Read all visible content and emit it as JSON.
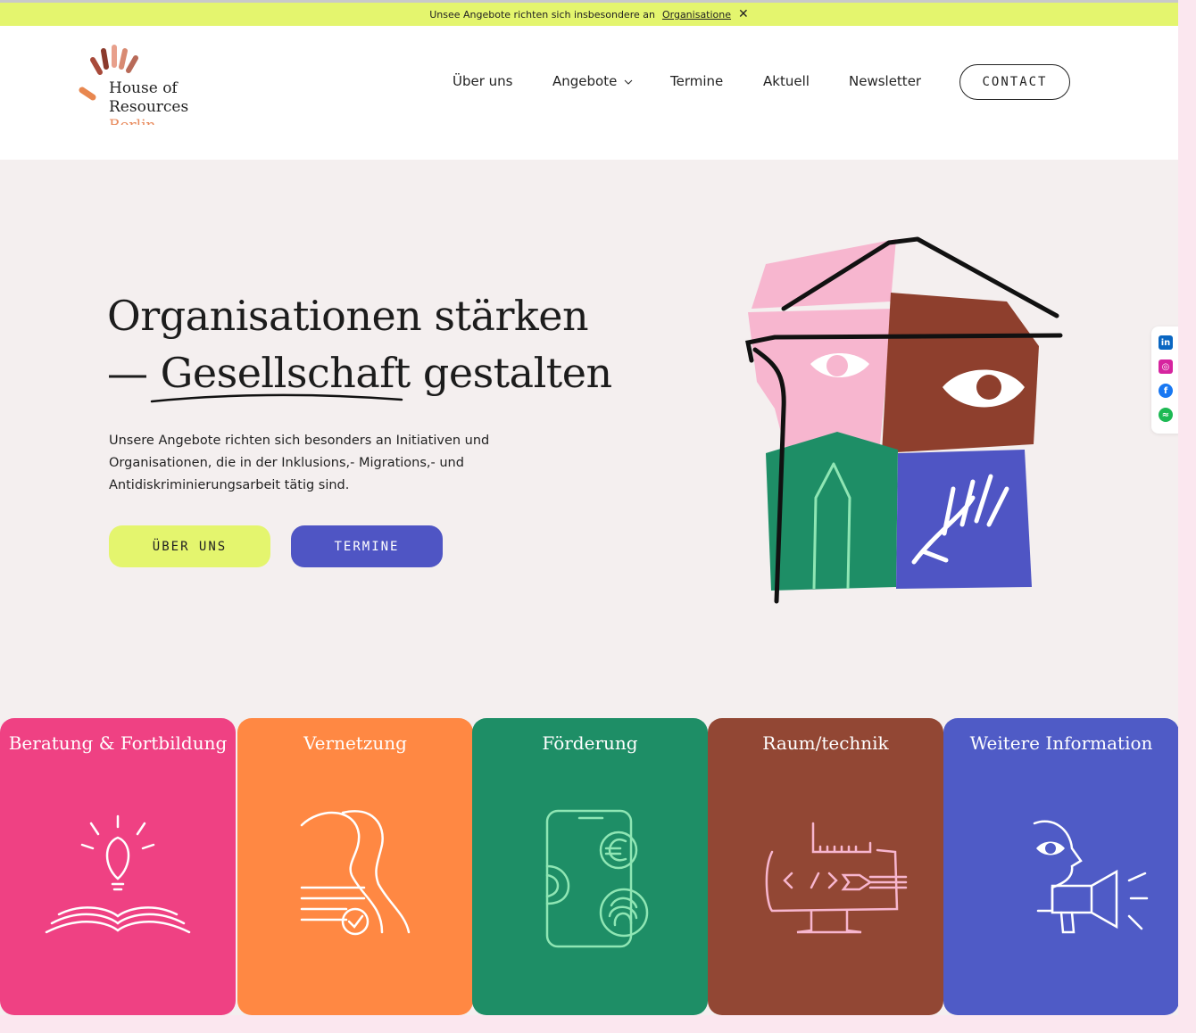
{
  "banner": {
    "text": "Unsee Angebote richten sich insbesondere an",
    "link": "Organisatione",
    "close": "✕"
  },
  "logo": {
    "line1": "House of",
    "line2": "Resources",
    "line3": "Berlin"
  },
  "nav": {
    "items": [
      "Über uns",
      "Angebote",
      "Termine",
      "Aktuell",
      "Newsletter"
    ],
    "dropdown_icon": "chevron-down-icon",
    "contact": "CONTACT"
  },
  "hero": {
    "title_line1": "Organisationen stärken",
    "title_line2": "— Gesellschaft gestalten",
    "description": "Unsere Angebote richten sich besonders an Initiativen und Organisationen, die in der Inklusions,- Migrations,- und Antidiskriminierungsarbeit tätig sind.",
    "btn_about": "ÜBER UNS",
    "btn_dates": "TERMINE"
  },
  "social": {
    "icons": [
      "linkedin-icon",
      "instagram-icon",
      "facebook-icon",
      "spotify-icon"
    ]
  },
  "cards": [
    {
      "title": "Beratung & Fortbildung",
      "color": "#ef4183",
      "icon": "book-lightbulb-icon"
    },
    {
      "title": "Vernetzung",
      "color": "#ff8843",
      "icon": "people-network-icon"
    },
    {
      "title": "Förderung",
      "color": "#1e8e66",
      "icon": "funding-phone-icon"
    },
    {
      "title": "Raum/technik",
      "color": "#924734",
      "icon": "monitor-code-icon"
    },
    {
      "title": "Weitere Information",
      "color": "#4f5bc6",
      "icon": "megaphone-icon"
    }
  ]
}
